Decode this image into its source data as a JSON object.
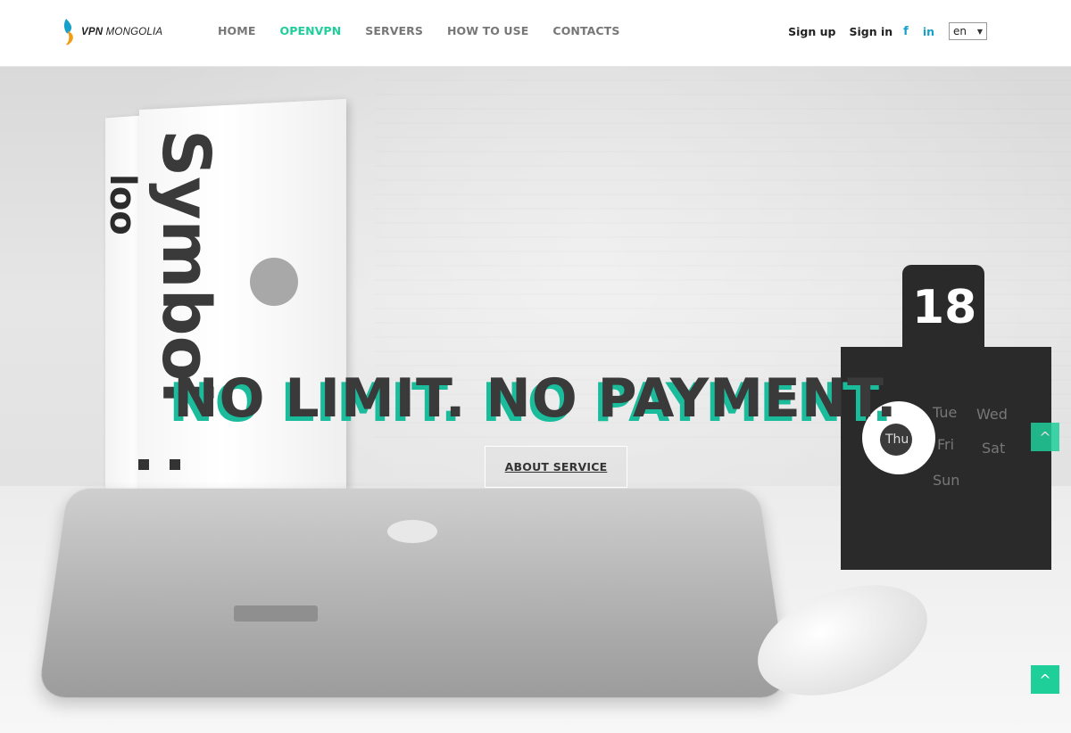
{
  "brand": {
    "name_bold": "VPN",
    "name_rest": " MONGOLIA",
    "accent_color": "#1fcf9a",
    "logo_colors": [
      "#17a0c8",
      "#f39c12"
    ]
  },
  "nav": {
    "items": [
      "HOME",
      "OPENVPN",
      "SERVERS",
      "HOW TO USE",
      "CONTACTS"
    ],
    "active_index": 1
  },
  "header_right": {
    "sign_up": "Sign up",
    "sign_in": "Sign in",
    "facebook": "f",
    "linkedin": "in",
    "language": "en"
  },
  "hero": {
    "headline": "NO LIMIT. NO PAYMENT.",
    "button": "ABOUT SERVICE",
    "photo": {
      "book_spine_text": "Symbol",
      "book_spine_small": "loo",
      "calendar_number": "18",
      "calendar_days": [
        "Tue",
        "Wed",
        "Thu",
        "Fri",
        "Sat",
        "Sun"
      ]
    }
  },
  "scroll_buttons": {
    "icon": "chevron-up-icon"
  }
}
